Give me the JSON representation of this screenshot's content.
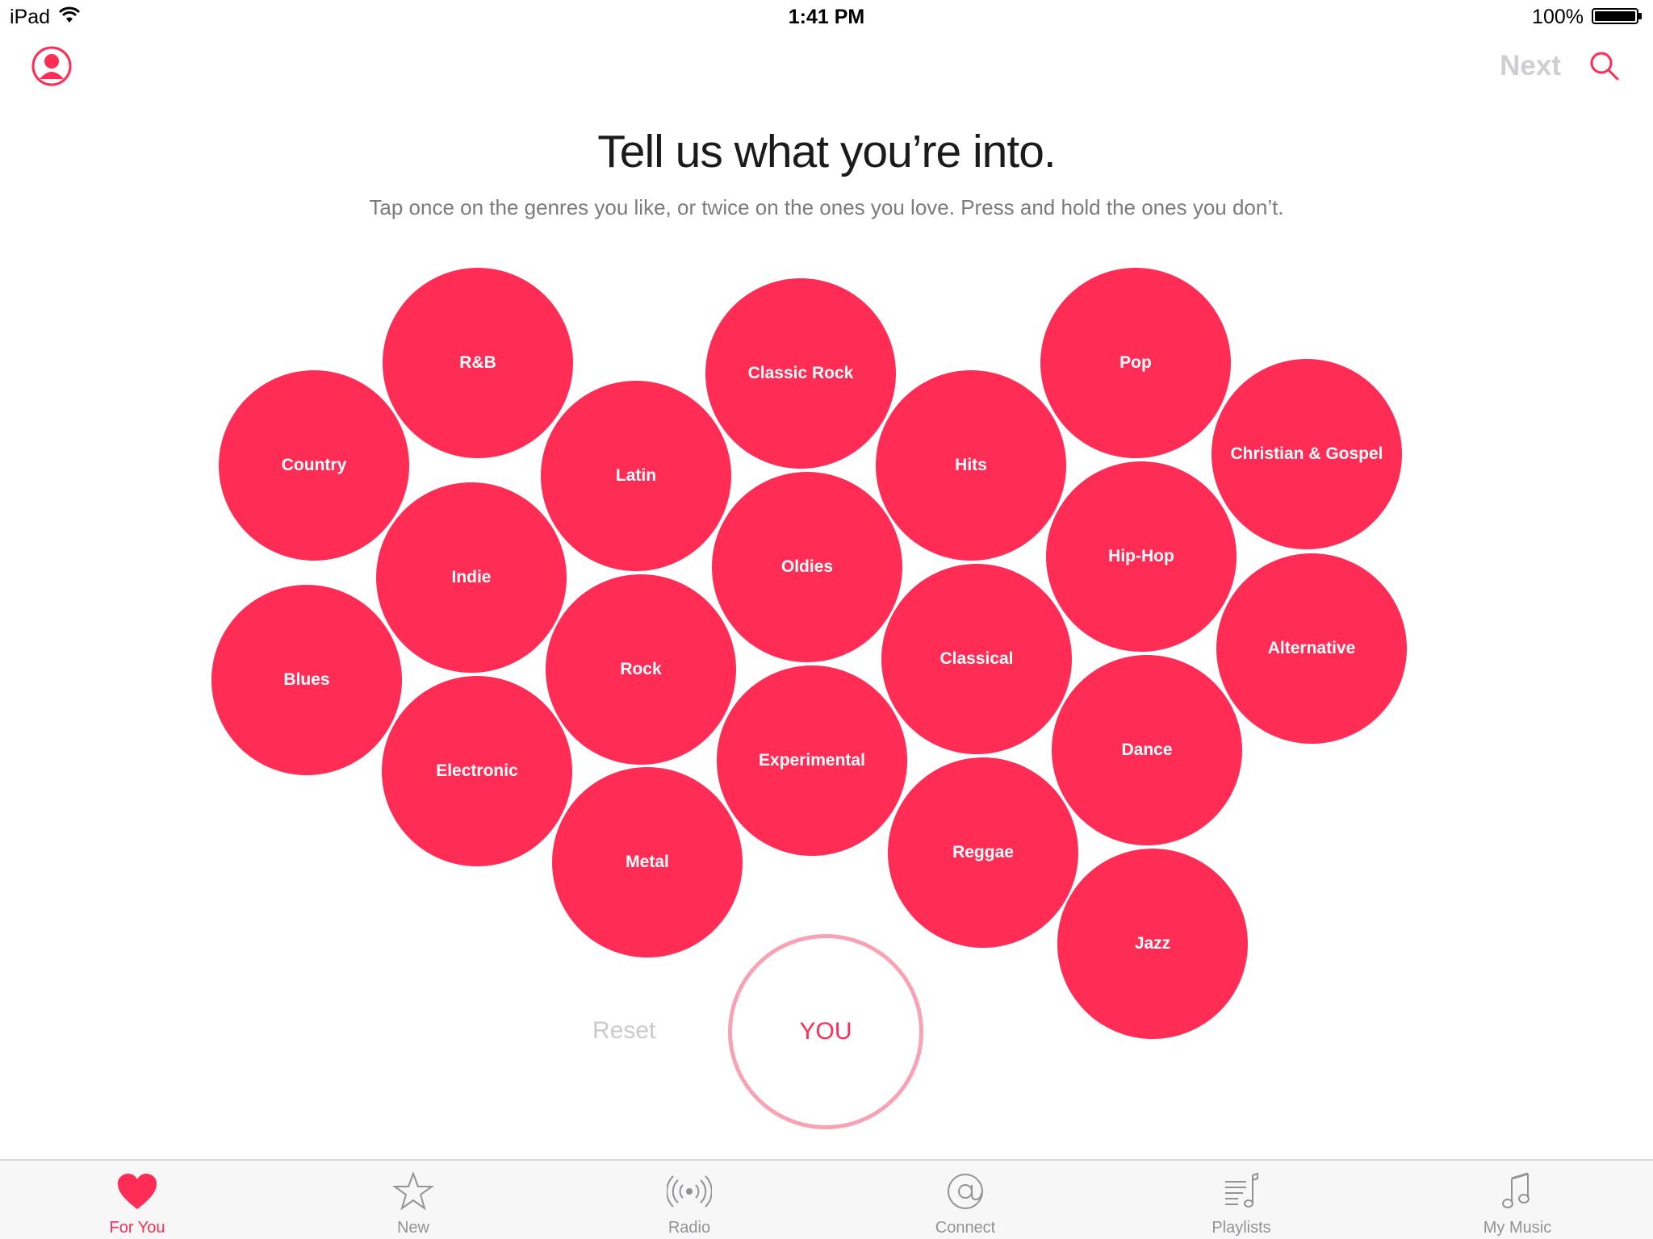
{
  "status_bar": {
    "device": "iPad",
    "time": "1:41 PM",
    "battery": "100%"
  },
  "nav": {
    "next_label": "Next",
    "profile_icon": "profile-icon",
    "search_icon": "search-icon"
  },
  "heading": {
    "title": "Tell us what you’re into.",
    "subtitle": "Tap once on the genres you like, or twice on the ones you love. Press and hold the ones you don’t."
  },
  "genres": [
    "R&B",
    "Classic Rock",
    "Pop",
    "Country",
    "Latin",
    "Hits",
    "Christian & Gospel",
    "Indie",
    "Oldies",
    "Hip-Hop",
    "Blues",
    "Rock",
    "Classical",
    "Alternative",
    "Electronic",
    "Experimental",
    "Dance",
    "Metal",
    "Reggae",
    "Jazz"
  ],
  "reset_label": "Reset",
  "you_label": "YOU",
  "tabs": [
    {
      "label": "For You",
      "icon": "heart-icon",
      "active": true
    },
    {
      "label": "New",
      "icon": "star-icon",
      "active": false
    },
    {
      "label": "Radio",
      "icon": "radio-icon",
      "active": false
    },
    {
      "label": "Connect",
      "icon": "at-sign-icon",
      "active": false
    },
    {
      "label": "Playlists",
      "icon": "playlist-icon",
      "active": false
    },
    {
      "label": "My Music",
      "icon": "music-note-icon",
      "active": false
    }
  ],
  "colors": {
    "accent": "#ff2d55",
    "you_ring": "#f8a3b5",
    "inactive_text": "#929297"
  }
}
